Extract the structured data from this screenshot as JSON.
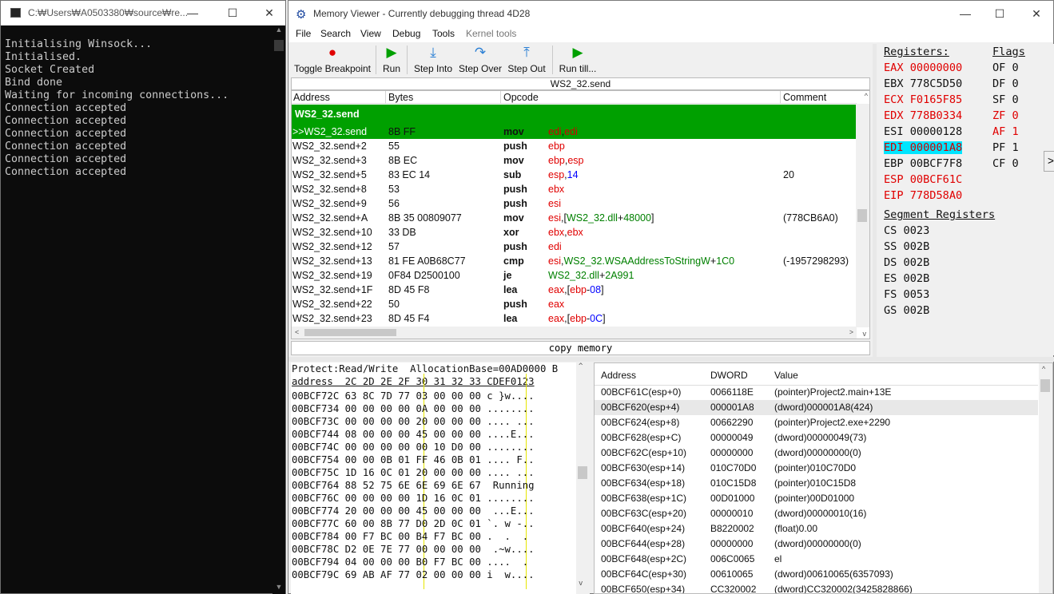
{
  "console": {
    "title": "C:₩Users₩A0503380₩source₩re...",
    "lines": [
      "Initialising Winsock...",
      "Initialised.",
      "Socket Created",
      "Bind done",
      "Waiting for incoming connections...",
      "Connection accepted",
      "Connection accepted",
      "Connection accepted",
      "Connection accepted",
      "Connection accepted",
      "Connection accepted"
    ]
  },
  "window": {
    "title": "Memory Viewer - Currently debugging thread 4D28",
    "menu": [
      "File",
      "Search",
      "View",
      "Debug",
      "Tools",
      "Kernel tools"
    ],
    "toolbar": [
      "Toggle Breakpoint",
      "Run",
      "Step Into",
      "Step Over",
      "Step Out",
      "Run till..."
    ]
  },
  "disasm": {
    "location": "WS2_32.send",
    "headers": [
      "Address",
      "Bytes",
      "Opcode",
      "Comment"
    ],
    "selected_function": "WS2_32.send",
    "rows": [
      {
        "addr": ">>WS2_32.send",
        "bytes": "8B FF",
        "op": "mov",
        "args": "edi,edi",
        "comment": ""
      },
      {
        "addr": "WS2_32.send+2",
        "bytes": "55",
        "op": "push",
        "args": "ebp",
        "comment": ""
      },
      {
        "addr": "WS2_32.send+3",
        "bytes": "8B EC",
        "op": "mov",
        "args": "ebp,esp",
        "comment": ""
      },
      {
        "addr": "WS2_32.send+5",
        "bytes": "83 EC 14",
        "op": "sub",
        "args": "esp,14",
        "comment": "20"
      },
      {
        "addr": "WS2_32.send+8",
        "bytes": "53",
        "op": "push",
        "args": "ebx",
        "comment": ""
      },
      {
        "addr": "WS2_32.send+9",
        "bytes": "56",
        "op": "push",
        "args": "esi",
        "comment": ""
      },
      {
        "addr": "WS2_32.send+A",
        "bytes": "8B 35 00809077",
        "op": "mov",
        "args": "esi,[WS2_32.dll+48000]",
        "comment": "(778CB6A0)"
      },
      {
        "addr": "WS2_32.send+10",
        "bytes": "33 DB",
        "op": "xor",
        "args": "ebx,ebx",
        "comment": ""
      },
      {
        "addr": "WS2_32.send+12",
        "bytes": "57",
        "op": "push",
        "args": "edi",
        "comment": ""
      },
      {
        "addr": "WS2_32.send+13",
        "bytes": "81 FE A0B68C77",
        "op": "cmp",
        "args": "esi,WS2_32.WSAAddressToStringW+1C0",
        "comment": "(-1957298293)"
      },
      {
        "addr": "WS2_32.send+19",
        "bytes": "0F84 D2500100",
        "op": "je",
        "args": "WS2_32.dll+2A991",
        "comment": ""
      },
      {
        "addr": "WS2_32.send+1F",
        "bytes": "8D 45 F8",
        "op": "lea",
        "args": "eax,[ebp-08]",
        "comment": ""
      },
      {
        "addr": "WS2_32.send+22",
        "bytes": "50",
        "op": "push",
        "args": "eax",
        "comment": ""
      },
      {
        "addr": "WS2_32.send+23",
        "bytes": "8D 45 F4",
        "op": "lea",
        "args": "eax,[ebp-0C]",
        "comment": ""
      }
    ],
    "copy_memory": "copy memory"
  },
  "registers": {
    "title": "Registers:",
    "flags_title": "Flags",
    "regs": [
      {
        "name": "EAX",
        "value": "00000000",
        "changed": true
      },
      {
        "name": "EBX",
        "value": "778C5D50",
        "changed": false
      },
      {
        "name": "ECX",
        "value": "F0165F85",
        "changed": true
      },
      {
        "name": "EDX",
        "value": "778B0334",
        "changed": true
      },
      {
        "name": "ESI",
        "value": "00000128",
        "changed": false
      },
      {
        "name": "EDI",
        "value": "000001A8",
        "changed": true
      },
      {
        "name": "EBP",
        "value": "00BCF7F8",
        "changed": false
      },
      {
        "name": "ESP",
        "value": "00BCF61C",
        "changed": true
      },
      {
        "name": "EIP",
        "value": "778D58A0",
        "changed": true
      }
    ],
    "flags": [
      {
        "name": "OF",
        "value": "0",
        "changed": false
      },
      {
        "name": "DF",
        "value": "0",
        "changed": false
      },
      {
        "name": "SF",
        "value": "0",
        "changed": false
      },
      {
        "name": "ZF",
        "value": "0",
        "changed": true
      },
      {
        "name": "AF",
        "value": "1",
        "changed": true
      },
      {
        "name": "PF",
        "value": "1",
        "changed": false
      },
      {
        "name": "CF",
        "value": "0",
        "changed": false
      }
    ],
    "segment_title": "Segment Registers",
    "segments": [
      {
        "name": "CS",
        "value": "0023"
      },
      {
        "name": "SS",
        "value": "002B"
      },
      {
        "name": "DS",
        "value": "002B"
      },
      {
        "name": "ES",
        "value": "002B"
      },
      {
        "name": "FS",
        "value": "0053"
      },
      {
        "name": "GS",
        "value": "002B"
      }
    ],
    "expand": ">"
  },
  "hex": {
    "info": "Protect:Read/Write  AllocationBase=00AD0000 B",
    "header": "address  2C 2D 2E 2F 30 31 32 33 CDEF0123",
    "rows": [
      "00BCF72C 63 8C 7D 77 03 00 00 00 c }w....",
      "00BCF734 00 00 00 00 0A 00 00 00 ........",
      "00BCF73C 00 00 00 00 20 00 00 00 .... ...",
      "00BCF744 08 00 00 00 45 00 00 00 ....E...",
      "00BCF74C 00 00 00 00 00 10 D0 00 ........",
      "00BCF754 00 00 0B 01 FF 46 0B 01 .... F..",
      "00BCF75C 1D 16 0C 01 20 00 00 00 .... ...",
      "00BCF764 88 52 75 6E 6E 69 6E 67  Running",
      "00BCF76C 00 00 00 00 1D 16 0C 01 ........",
      "00BCF774 20 00 00 00 45 00 00 00  ...E...",
      "00BCF77C 60 00 8B 77 D0 2D 0C 01 `. w -..",
      "00BCF784 00 F7 BC 00 B4 F7 BC 00 .  .  .",
      "00BCF78C D2 0E 7E 77 00 00 00 00  .~w....",
      "00BCF794 04 00 00 00 B0 F7 BC 00 ....  .",
      "00BCF79C 69 AB AF 77 02 00 00 00 i  w...."
    ]
  },
  "stack": {
    "headers": [
      "Address",
      "DWORD",
      "Value"
    ],
    "rows": [
      {
        "addr": "00BCF61C(esp+0)",
        "dword": "0066118E",
        "value": "(pointer)Project2.main+13E"
      },
      {
        "addr": "00BCF620(esp+4)",
        "dword": "000001A8",
        "value": "(dword)000001A8(424)"
      },
      {
        "addr": "00BCF624(esp+8)",
        "dword": "00662290",
        "value": "(pointer)Project2.exe+2290"
      },
      {
        "addr": "00BCF628(esp+C)",
        "dword": "00000049",
        "value": "(dword)00000049(73)"
      },
      {
        "addr": "00BCF62C(esp+10)",
        "dword": "00000000",
        "value": "(dword)00000000(0)"
      },
      {
        "addr": "00BCF630(esp+14)",
        "dword": "010C70D0",
        "value": "(pointer)010C70D0"
      },
      {
        "addr": "00BCF634(esp+18)",
        "dword": "010C15D8",
        "value": "(pointer)010C15D8"
      },
      {
        "addr": "00BCF638(esp+1C)",
        "dword": "00D01000",
        "value": "(pointer)00D01000"
      },
      {
        "addr": "00BCF63C(esp+20)",
        "dword": "00000010",
        "value": "(dword)00000010(16)"
      },
      {
        "addr": "00BCF640(esp+24)",
        "dword": "B8220002",
        "value": "(float)0.00"
      },
      {
        "addr": "00BCF644(esp+28)",
        "dword": "00000000",
        "value": "(dword)00000000(0)"
      },
      {
        "addr": "00BCF648(esp+2C)",
        "dword": "006C0065",
        "value": "el"
      },
      {
        "addr": "00BCF64C(esp+30)",
        "dword": "00610065",
        "value": "(dword)00610065(6357093)"
      },
      {
        "addr": "00BCF650(esp+34)",
        "dword": "CC320002",
        "value": "(dword)CC320002(3425828866)"
      }
    ]
  },
  "colors": {
    "green": "#00a000",
    "red": "#e00000",
    "accent": "#00c8ff",
    "blue": "#0000ff",
    "darkgreen": "#008000"
  }
}
